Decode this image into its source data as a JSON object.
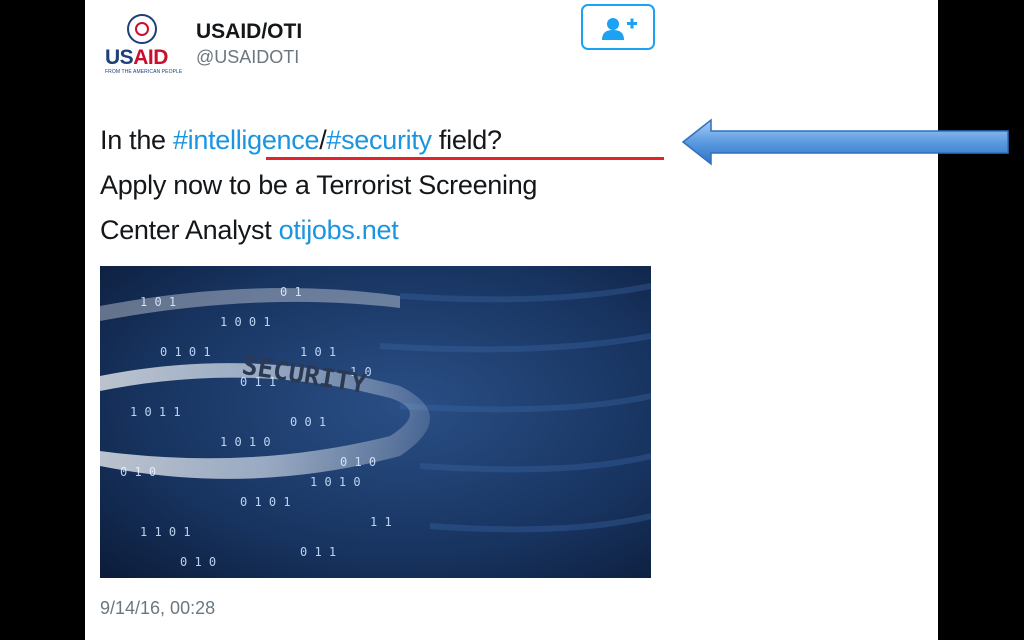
{
  "user": {
    "logo_text": "USAID",
    "logo_text_part1": "US",
    "logo_text_part2": "AID",
    "logo_tagline": "FROM THE AMERICAN PEOPLE",
    "display_name": "USAID/OTI",
    "handle": "@USAIDOTI"
  },
  "follow_button": {
    "icon": "add-user-icon"
  },
  "tweet": {
    "prefix": "In the ",
    "hashtag1": "#intelligence",
    "slash": "/",
    "hashtag2": "#security",
    "after_hashtags": " field?",
    "line2": "Apply now to be a Terrorist Screening",
    "line3_prefix": "Center Analyst ",
    "link": "otijobs.net"
  },
  "media": {
    "overlay_word": "SECURITY"
  },
  "timestamp": "9/14/16, 00:28",
  "colors": {
    "link": "#1b95e0",
    "underline": "#e0242a",
    "arrow": "#5b9be0"
  }
}
